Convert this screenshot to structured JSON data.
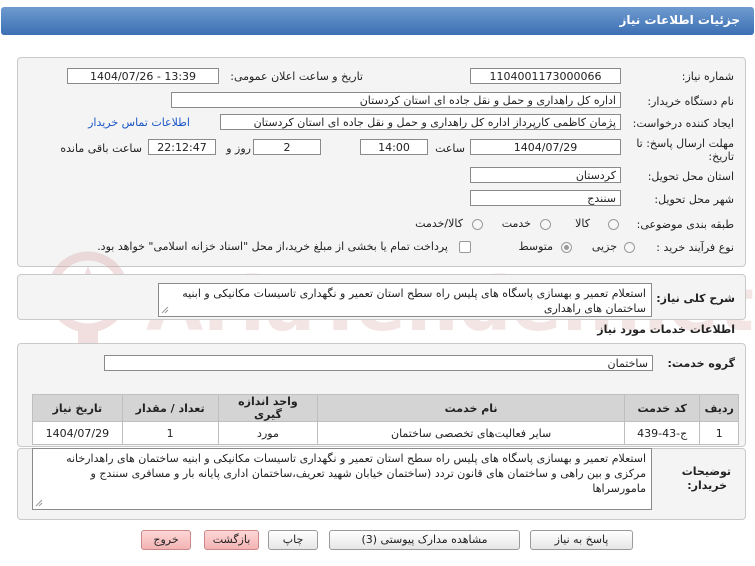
{
  "header": {
    "title": "جزئیات اطلاعات نیاز"
  },
  "fields": {
    "need_number_label": "شماره نیاز:",
    "need_number": "1104001173000066",
    "announce_label": "تاریخ و ساعت اعلان عمومی:",
    "announce_value": "1404/07/26 - 13:39",
    "buyer_org_label": "نام دستگاه خریدار:",
    "buyer_org": "اداره کل راهداری و حمل و نقل جاده ای استان کردستان",
    "creator_label": "ایجاد کننده درخواست:",
    "creator": "پژمان کاظمی کارپرداز اداره کل راهداری و حمل و نقل جاده ای استان کردستان",
    "contact_link": "اطلاعات تماس خریدار",
    "deadline_label_1": "مهلت ارسال پاسخ: تا",
    "deadline_label_2": "تاریخ:",
    "deadline_date": "1404/07/29",
    "time_label": "ساعت",
    "deadline_time": "14:00",
    "days_value": "2",
    "days_label": "روز و",
    "remaining_time": "22:12:47",
    "remaining_label": "ساعت باقی مانده",
    "province_label": "استان محل تحویل:",
    "province": "کردستان",
    "city_label": "شهر محل تحویل:",
    "city": "سنندج"
  },
  "category": {
    "label": "طبقه بندی موضوعی:",
    "options": [
      {
        "label": "کالا",
        "selected": false
      },
      {
        "label": "خدمت",
        "selected": false
      },
      {
        "label": "کالا/خدمت",
        "selected": false
      }
    ]
  },
  "process": {
    "label": "نوع فرآیند خرید :",
    "options": [
      {
        "label": "جزیی",
        "selected": false
      },
      {
        "label": "متوسط",
        "selected": true
      }
    ],
    "payment_note": "پرداخت تمام یا بخشی از مبلغ خرید،از محل \"اسناد خزانه اسلامی\" خواهد بود."
  },
  "summary": {
    "label": "شرح کلی نیاز:",
    "text": "استعلام تعمیر و بهسازی پاسگاه های پلیس راه سطح استان تعمیر و نگهداری تاسیسات مکانیکی و ابنیه ساختمان های راهداری"
  },
  "services_section": {
    "title": "اطلاعات خدمات مورد نیاز",
    "group_label": "گروه خدمت:",
    "group_value": "ساختمان"
  },
  "table": {
    "columns": [
      "ردیف",
      "کد خدمت",
      "نام خدمت",
      "واحد اندازه گیری",
      "تعداد / مقدار",
      "تاریخ نیاز"
    ],
    "rows": [
      [
        "1",
        "ج-43-439",
        "سایر فعالیت‌های تخصصی ساختمان",
        "مورد",
        "1",
        "1404/07/29"
      ]
    ]
  },
  "buyer_notes": {
    "label_1": "توضیحات",
    "label_2": "خریدار:",
    "text": "استعلام تعمیر و بهسازی پاسگاه های پلیس راه سطح استان تعمیر و نگهداری تاسیسات مکانیکی و ابنیه ساختمان های راهدارخانه مرکزی و بین راهی و ساختمان های قانون تردد (ساختمان خیابان شهید تعریف،ساختمان اداری پایانه بار و مسافری سنندج و مامورسراها"
  },
  "buttons": {
    "reply": "پاسخ به نیاز",
    "attachments": "مشاهده مدارک پیوستی (3)",
    "print": "چاپ",
    "back": "بازگشت",
    "exit": "خروج"
  },
  "watermark": {
    "text": "AriaTender.net"
  },
  "colors": {
    "header_top": "#6f9bd0",
    "header_bottom": "#3c6fb3",
    "link": "#1a56c8",
    "panel_bg": "#f4f4f4"
  }
}
